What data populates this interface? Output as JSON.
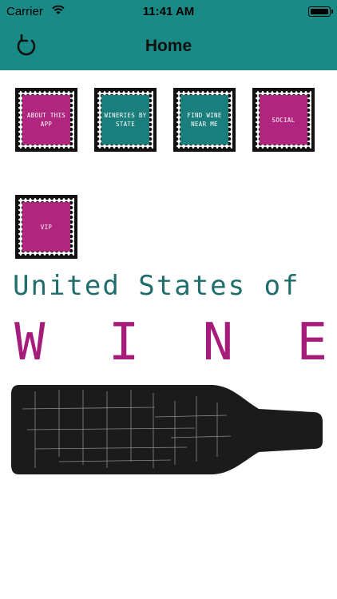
{
  "status": {
    "carrier": "Carrier",
    "time": "11:41 AM"
  },
  "nav": {
    "title": "Home"
  },
  "menu": [
    {
      "label": "ABOUT THIS APP",
      "color": "#b0257e"
    },
    {
      "label": "WINERIES BY STATE",
      "color": "#1a7f7c"
    },
    {
      "label": "FIND WINE NEAR ME",
      "color": "#1a7f7c"
    },
    {
      "label": "SOCIAL",
      "color": "#b0257e"
    },
    {
      "label": "VIP",
      "color": "#b0257e"
    }
  ],
  "logo": {
    "line1": "United States of",
    "letters": [
      "W",
      "I",
      "N",
      "E"
    ]
  },
  "colors": {
    "bar": "#1a8a86",
    "teal_text": "#1f6e6c",
    "magenta_text": "#a51c7b"
  }
}
